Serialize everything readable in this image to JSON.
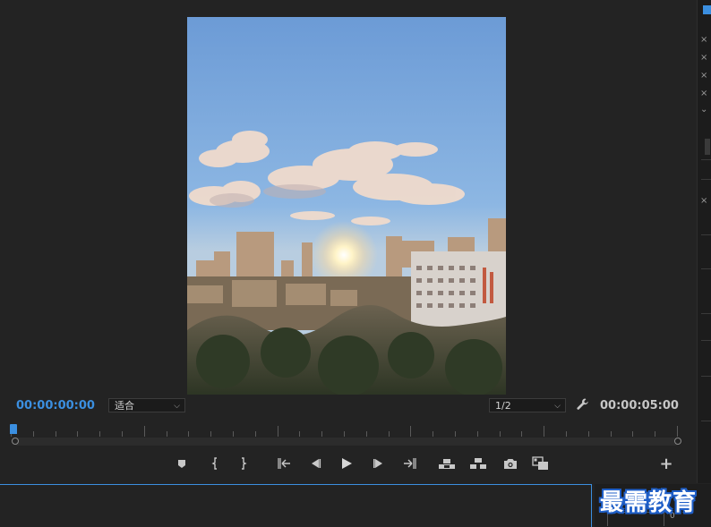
{
  "monitor": {
    "current_timecode": "00:00:00:00",
    "duration_timecode": "00:00:05:00",
    "zoom_select": {
      "value": "适合"
    },
    "resolution_select": {
      "value": "1/2"
    }
  },
  "transport": {
    "buttons": [
      {
        "id": "add-marker",
        "icon": "marker-icon"
      },
      {
        "id": "mark-in",
        "icon": "mark-in-icon"
      },
      {
        "id": "mark-out",
        "icon": "mark-out-icon"
      },
      {
        "id": "go-to-in",
        "icon": "go-to-in-icon"
      },
      {
        "id": "step-back",
        "icon": "step-back-icon"
      },
      {
        "id": "play",
        "icon": "play-icon"
      },
      {
        "id": "step-forward",
        "icon": "step-forward-icon"
      },
      {
        "id": "go-to-out",
        "icon": "go-to-out-icon"
      },
      {
        "id": "lift",
        "icon": "lift-icon"
      },
      {
        "id": "extract",
        "icon": "extract-icon"
      },
      {
        "id": "export-frame",
        "icon": "camera-icon"
      },
      {
        "id": "comparison-view",
        "icon": "compare-icon"
      }
    ],
    "add_button": "+"
  },
  "watermark": {
    "text": "最需教育"
  },
  "mini_readout": {
    "zero": "0"
  },
  "colors": {
    "accent_blue": "#3b8fe0",
    "panel_bg": "#232323",
    "watermark_outline": "#1f5fc8"
  }
}
